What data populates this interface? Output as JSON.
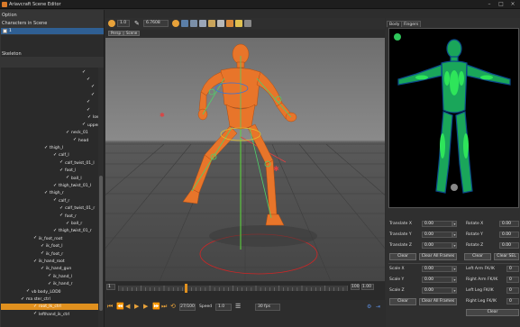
{
  "app": {
    "title": "Ariavcraft Scene Editor"
  },
  "left_panel": {
    "menu": "Option",
    "section_characters": "Characters in Scene",
    "character_first": "1",
    "section_skeleton": "Skeleton",
    "tree": [
      {
        "label": "",
        "indent": 90
      },
      {
        "label": "",
        "indent": 95
      },
      {
        "label": "",
        "indent": 100
      },
      {
        "label": "",
        "indent": 100
      },
      {
        "label": "",
        "indent": 95
      },
      {
        "label": "",
        "indent": 95
      },
      {
        "label": "lowe",
        "indent": 96
      },
      {
        "label": "uppere",
        "indent": 90
      },
      {
        "label": "neck_01",
        "indent": 72
      },
      {
        "label": "head",
        "indent": 80
      },
      {
        "label": "thigh_l",
        "indent": 48
      },
      {
        "label": "calf_l",
        "indent": 58
      },
      {
        "label": "calf_twist_01_l",
        "indent": 65
      },
      {
        "label": "foot_l",
        "indent": 65
      },
      {
        "label": "ball_l",
        "indent": 72
      },
      {
        "label": "thigh_twist_01_l",
        "indent": 58
      },
      {
        "label": "thigh_r",
        "indent": 48
      },
      {
        "label": "calf_r",
        "indent": 58
      },
      {
        "label": "calf_twist_01_r",
        "indent": 65
      },
      {
        "label": "foot_r",
        "indent": 65
      },
      {
        "label": "ball_r",
        "indent": 72
      },
      {
        "label": "thigh_twist_01_r",
        "indent": 58
      },
      {
        "label": "ik_foot_root",
        "indent": 36
      },
      {
        "label": "ik_foot_l",
        "indent": 44
      },
      {
        "label": "ik_foot_r",
        "indent": 44
      },
      {
        "label": "ik_hand_root",
        "indent": 36
      },
      {
        "label": "ik_hand_gun",
        "indent": 44
      },
      {
        "label": "ik_hand_l",
        "indent": 52
      },
      {
        "label": "ik_hand_r",
        "indent": 52
      },
      {
        "label": "vb body_LOD0",
        "indent": 28
      },
      {
        "label": "ma ster_ctrl",
        "indent": 22
      },
      {
        "label": "root_lk_ctrl",
        "indent": 36,
        "selected": true
      },
      {
        "label": "lefthand_ik_ctrl",
        "indent": 36
      }
    ]
  },
  "toolbar": {
    "frame_value": "1.0",
    "number_value": "6.7608",
    "view_tabs": [
      "Persp",
      "Scene"
    ]
  },
  "timeline": {
    "current_frame": "1",
    "end_frame": "100",
    "end_frame_b": "1.00"
  },
  "playback": {
    "frame_display": "27/100",
    "speed_label": "Speed",
    "speed_value": "1.0",
    "fps_value": "30 fps"
  },
  "right_panel": {
    "tabs": [
      "Body",
      "Fingers"
    ],
    "translate_x_label": "Translate X",
    "translate_y_label": "Translate Y",
    "translate_z_label": "Translate Z",
    "rotate_x_label": "Rotate X",
    "rotate_y_label": "Rotate Y",
    "rotate_z_label": "Rotate Z",
    "translate_x": "0.00",
    "translate_y": "0.00",
    "translate_z": "0.00",
    "rotate_x": "0.00",
    "rotate_y": "0.00",
    "rotate_z": "0.00",
    "clear_label": "Clear",
    "clear_all_frames_label": "Clear All Frames",
    "clear_sel_label": "Clear SEL",
    "scale_x_label": "Scale X",
    "scale_y_label": "Scale Y",
    "scale_z_label": "Scale Z",
    "scale_x": "0.00",
    "scale_y": "0.00",
    "scale_z": "0.00",
    "left_arm_fk_label": "Left Arm FK/IK",
    "right_arm_fk_label": "Right Arm FK/IK",
    "left_leg_fk_label": "Left Leg FK/IK",
    "right_leg_fk_label": "Right Leg FK/IK",
    "left_arm_fk": "0",
    "right_arm_fk": "0",
    "left_leg_fk": "0",
    "right_leg_fk": "0",
    "clear_ik_label": "Clear",
    "clear_ik_all_label": "Clear All Frames",
    "clear_ik_sel_label": "Clear"
  },
  "colors": {
    "accent_selection": "#e0901e",
    "character_row": "#2f5f93",
    "body_map_fill": "#1aa65a",
    "character_orange": "#e8752a"
  }
}
